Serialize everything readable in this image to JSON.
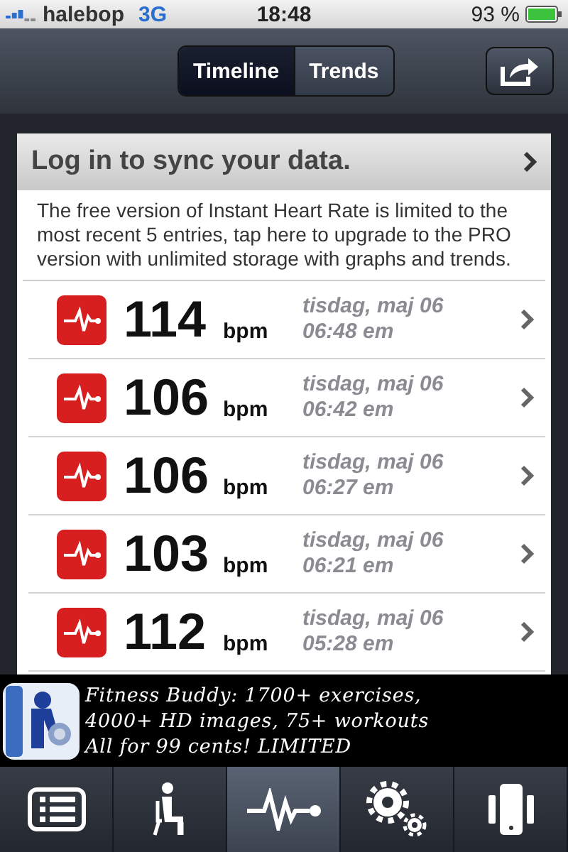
{
  "status_bar": {
    "carrier": "halebop",
    "network": "3G",
    "time": "18:48",
    "battery": "93 %"
  },
  "nav": {
    "segments": [
      {
        "label": "Timeline",
        "selected": true
      },
      {
        "label": "Trends",
        "selected": false
      }
    ]
  },
  "login": {
    "label": "Log in to sync your data."
  },
  "notice": "The free version of Instant Heart Rate is limited to the most recent 5 entries, tap here to upgrade to the PRO version with unlimited storage with graphs and trends.",
  "entries": [
    {
      "value": "114",
      "unit": "bpm",
      "date": "tisdag, maj 06",
      "time": "06:48 em"
    },
    {
      "value": "106",
      "unit": "bpm",
      "date": "tisdag, maj 06",
      "time": "06:42 em"
    },
    {
      "value": "106",
      "unit": "bpm",
      "date": "tisdag, maj 06",
      "time": "06:27 em"
    },
    {
      "value": "103",
      "unit": "bpm",
      "date": "tisdag, maj 06",
      "time": "06:21 em"
    },
    {
      "value": "112",
      "unit": "bpm",
      "date": "tisdag, maj 06",
      "time": "05:28 em"
    }
  ],
  "ad": {
    "lines": [
      "Fitness Buddy: 1700+ exercises,",
      "4000+ HD images, 75+ workouts",
      "All for 99 cents! LIMITED"
    ]
  },
  "tab_bar": [
    {
      "kind": "list",
      "selected": false
    },
    {
      "kind": "person",
      "selected": false
    },
    {
      "kind": "pulse",
      "selected": true
    },
    {
      "kind": "settings",
      "selected": false
    },
    {
      "kind": "device",
      "selected": false
    }
  ]
}
